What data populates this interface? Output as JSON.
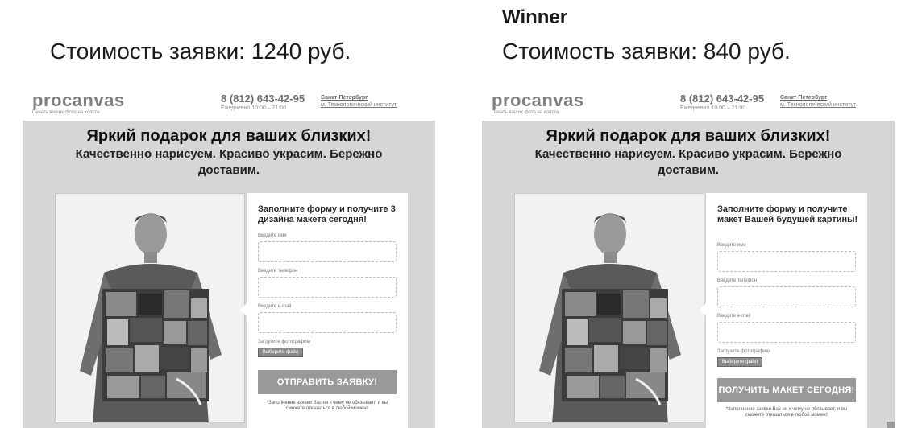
{
  "left": {
    "price": "Стоимость заявки: 1240 руб.",
    "form_title": "Заполните форму и получите 3 дизайна макета сегодня!",
    "button_label": "ОТПРАВИТЬ ЗАЯВКУ!"
  },
  "right": {
    "winner_label": "Winner",
    "price": "Стоимость заявки: 840 руб.",
    "form_title": "Заполните форму и получите макет Вашей будущей картины!",
    "button_label": "ПОЛУЧИТЬ МАКЕТ СЕГОДНЯ!"
  },
  "shared": {
    "logo": "procanvas",
    "logo_tagline": "Печать ваших фото на холсте",
    "phone": "8 (812) 643-42-95",
    "hours": "Ежедневно 10:00 – 21:00",
    "address_line1": "Санкт-Петербург",
    "address_line2": "м. Технологический институт",
    "headline": "Яркий подарок для ваших близких!",
    "subline": "Качественно нарисуем. Красиво украсим. Бережно доставим.",
    "field_name_label": "Введите имя",
    "field_phone_label": "Введите телефон",
    "field_email_label": "Введите e-mail",
    "upload_label": "Загрузите фотографию",
    "upload_button": "Выберите файл",
    "note": "*Заполнение заявки Вас ни к чему не обязывает, и вы сможете отказаться в любой момент"
  },
  "colors": {
    "hero_bg": "#d6d6d6",
    "button_bg": "#999999",
    "logo": "#7f7f7f"
  }
}
